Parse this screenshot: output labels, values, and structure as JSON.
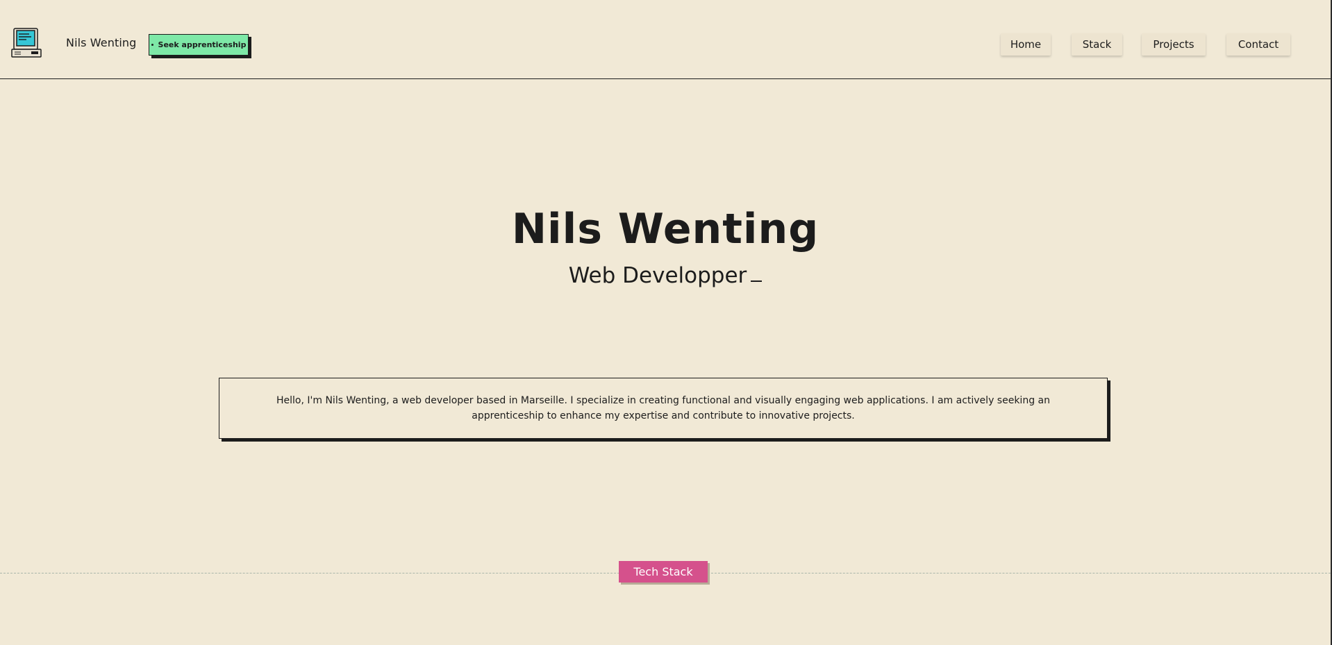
{
  "header": {
    "logo_icon": "retro-computer-icon",
    "site_name": "Nils Wenting",
    "status_badge": "Seek apprenticeship",
    "status_color": "#7ee8a7"
  },
  "nav": {
    "items": [
      {
        "label": "Home"
      },
      {
        "label": "Stack"
      },
      {
        "label": "Projects"
      },
      {
        "label": "Contact"
      }
    ]
  },
  "hero": {
    "title": "Nils Wenting",
    "subtitle": "Web Developper"
  },
  "intro": {
    "text": "Hello, I'm Nils Wenting, a web developer based in Marseille. I specialize in creating functional and visually engaging web applications. I am actively seeking an apprenticeship to enhance my expertise and contribute to innovative projects."
  },
  "section": {
    "tech_stack_label": "Tech Stack",
    "accent_color": "#d5518c"
  },
  "colors": {
    "background": "#f1e9d6",
    "text": "#1c1c1c"
  }
}
